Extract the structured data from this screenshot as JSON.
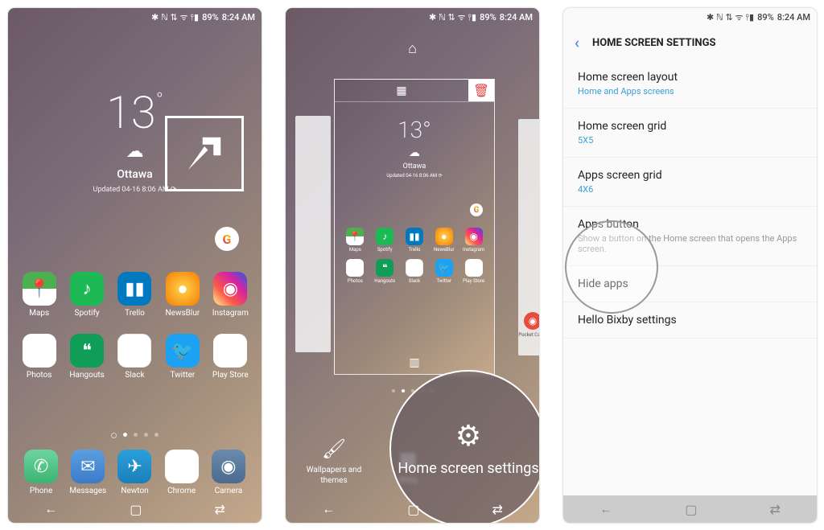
{
  "status": {
    "icons": "✱ ℕ ⇅ ᯤ ⫯▮",
    "battery": "89%",
    "time": "8:24 AM"
  },
  "weather": {
    "temp": "13",
    "city": "Ottawa",
    "updated": "Updated 04-16 8:06 AM  ⟳"
  },
  "apps_row1": [
    {
      "label": "Maps",
      "ico": "📍",
      "cls": "bg-maps"
    },
    {
      "label": "Spotify",
      "ico": "♪",
      "cls": "bg-spotify"
    },
    {
      "label": "Trello",
      "ico": "▮▮",
      "cls": "bg-trello"
    },
    {
      "label": "NewsBlur",
      "ico": "●",
      "cls": "bg-newsblur"
    },
    {
      "label": "Instagram",
      "ico": "◉",
      "cls": "bg-instagram"
    }
  ],
  "apps_row2": [
    {
      "label": "Photos",
      "ico": "✦",
      "cls": "bg-photos"
    },
    {
      "label": "Hangouts",
      "ico": "❝",
      "cls": "bg-hangouts"
    },
    {
      "label": "Slack",
      "ico": "✱",
      "cls": "bg-slack"
    },
    {
      "label": "Twitter",
      "ico": "🐦",
      "cls": "bg-twitter"
    },
    {
      "label": "Play Store",
      "ico": "▶",
      "cls": "bg-playstore"
    }
  ],
  "dock": [
    {
      "label": "Phone",
      "ico": "✆",
      "cls": "bg-phone"
    },
    {
      "label": "Messages",
      "ico": "✉",
      "cls": "bg-messages"
    },
    {
      "label": "Newton",
      "ico": "✈",
      "cls": "bg-newton"
    },
    {
      "label": "Chrome",
      "ico": "◉",
      "cls": "bg-chrome"
    },
    {
      "label": "Camera",
      "ico": "◉",
      "cls": "bg-camera"
    }
  ],
  "edit": {
    "wallpapers": "Wallpapers and themes",
    "widgets": "Widg",
    "zoom_label": "Home screen settings",
    "pocket": "Pocket Casts"
  },
  "settings": {
    "title": "HOME SCREEN SETTINGS",
    "items": [
      {
        "title": "Home screen layout",
        "value": "Home and Apps screens"
      },
      {
        "title": "Home screen grid",
        "value": "5X5"
      },
      {
        "title": "Apps screen grid",
        "value": "4X6"
      },
      {
        "title": "Apps button",
        "desc": "Show a button on the Home screen that opens the Apps screen."
      },
      {
        "title": "Hide apps",
        "value": ""
      },
      {
        "title": "Hello Bixby settings",
        "value": ""
      }
    ]
  },
  "nav": {
    "back": "←",
    "home": "▢",
    "recent": "⇄"
  }
}
